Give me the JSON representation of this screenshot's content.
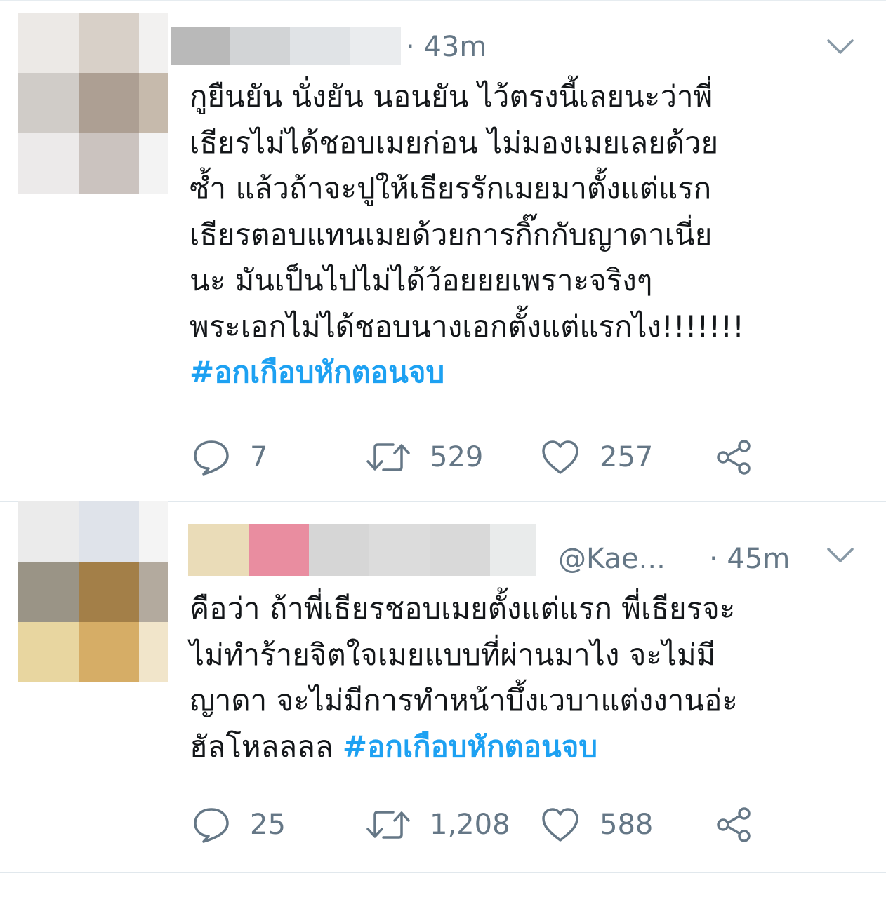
{
  "tweets": [
    {
      "time": "· 43m",
      "text": "กูยืนยัน นั่งยัน นอนยัน ไว้ตรงนี้เลยนะว่าพี่\nเธียรไม่ได้ชอบเมยก่อน ไม่มองเมยเลยด้วย\nซ้ำ แล้วถ้าจะปูให้เธียรรักเมยมาตั้งแต่แรก\nเธียรตอบแทนเมยด้วยการกิ๊กกับญาดาเนี่ย\nนะ มันเป็นไปไม่ได้ว้อยยยเพราะจริงๆ\nพระเอกไม่ได้ชอบนางเอกตั้งแต่แรกไง!!!!!!!",
      "hashtag": "#อกเกือบหักตอนจบ",
      "replies": "7",
      "retweets": "529",
      "likes": "257"
    },
    {
      "handle": "@Kae...",
      "time": "· 45m",
      "text": "คือว่า ถ้าพี่เธียรชอบเมยตั้งแต่แรก พี่เธียรจะ\nไม่ทำร้ายจิตใจเมยแบบที่ผ่านมาไง จะไม่มี\nญาดา จะไม่มีการทำหน้าบึ้งเวบาแต่งงานอ่ะ\nฮัลโหลลลล ",
      "hashtag": "#อกเกือบหักตอนจบ",
      "replies": "25",
      "retweets": "1,208",
      "likes": "588"
    }
  ],
  "icons": {
    "reply": "speech-bubble-icon",
    "retweet": "retweet-arrows-icon",
    "like": "heart-icon",
    "share": "share-nodes-icon",
    "menu": "chevron-down-icon"
  },
  "colors": {
    "hashtag": "#1da1f2",
    "secondary": "#657786",
    "text": "#14171a",
    "divider": "#e1e8ed"
  }
}
